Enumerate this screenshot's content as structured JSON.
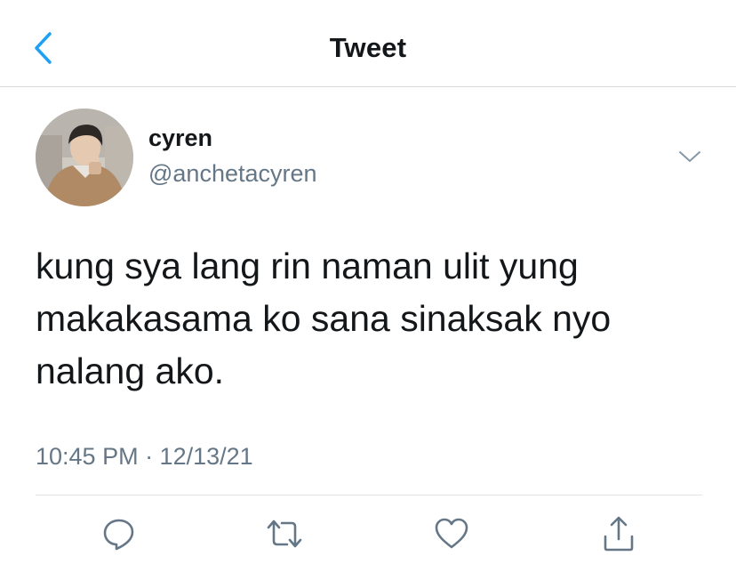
{
  "header": {
    "title": "Tweet",
    "back_icon": "chevron-left-icon",
    "accent_color": "#1da1f2"
  },
  "tweet": {
    "author": {
      "name": "cyren",
      "handle": "@anchetacyren",
      "avatar_icon": "profile-photo"
    },
    "menu_icon": "chevron-down-icon",
    "text": "kung sya lang rin naman ulit yung makakasama ko sana sinaksak nyo nalang ako.",
    "timestamp": "10:45 PM · 12/13/21"
  },
  "actions": [
    {
      "name": "reply",
      "icon": "reply-icon"
    },
    {
      "name": "retweet",
      "icon": "retweet-icon"
    },
    {
      "name": "like",
      "icon": "heart-icon"
    },
    {
      "name": "share",
      "icon": "share-icon"
    }
  ],
  "colors": {
    "text": "#14171a",
    "secondary_text": "#657786",
    "icon_gray": "#657786",
    "divider": "#e1e4e6"
  }
}
